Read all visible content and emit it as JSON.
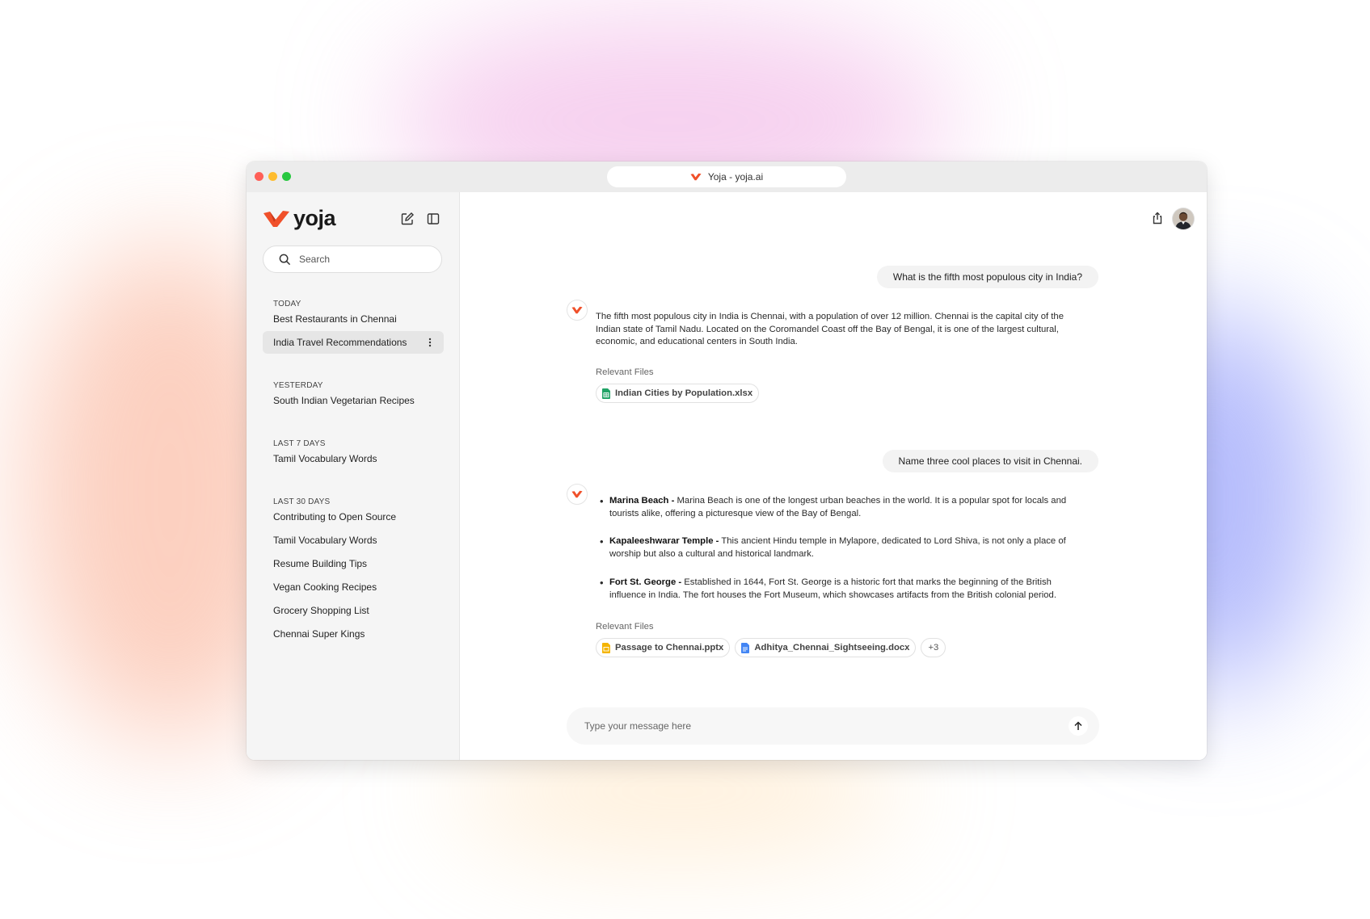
{
  "colors": {
    "brand": "#f0502a",
    "sidebar_bg": "#f5f5f5",
    "active_item_bg": "#e6e6e6",
    "user_bubble_bg": "#f3f3f3",
    "sheet_icon": "#21a366",
    "slides_icon": "#f4b400",
    "doc_icon": "#4285f4"
  },
  "browser": {
    "tab_title": "Yoja - yoja.ai"
  },
  "sidebar": {
    "logo_text": "yoja",
    "search_placeholder": "Search",
    "sections": [
      {
        "title": "TODAY",
        "items": [
          "Best Restaurants in Chennai",
          "India Travel Recommendations"
        ]
      },
      {
        "title": "YESTERDAY",
        "items": [
          "South Indian Vegetarian Recipes"
        ]
      },
      {
        "title": "LAST 7 DAYS",
        "items": [
          "Tamil Vocabulary Words"
        ]
      },
      {
        "title": "LAST 30 DAYS",
        "items": [
          "Contributing to Open Source",
          "Tamil Vocabulary Words",
          "Resume Building Tips",
          "Vegan Cooking Recipes",
          "Grocery Shopping List",
          "Chennai Super Kings"
        ]
      }
    ],
    "active_item": "India Travel Recommendations"
  },
  "conversation": [
    {
      "user": "What is the fifth most populous city in India?",
      "answer": "The fifth most populous city in India is Chennai, with a population of over 12 million. Chennai is the capital city of the Indian state of Tamil Nadu. Located on the Coromandel Coast off the Bay of Bengal, it is one of the largest cultural, economic, and educational centers in South India.",
      "relevant_label": "Relevant Files",
      "files": [
        {
          "name": "Indian Cities by Population.xlsx",
          "icon": "spreadsheet-icon"
        }
      ]
    },
    {
      "user": "Name three cool places to visit in Chennai.",
      "bullets": [
        {
          "title": "Marina Beach -",
          "text": " Marina Beach is one of the longest urban beaches in the world. It is a popular spot for locals and tourists alike, offering a picturesque view of the Bay of Bengal."
        },
        {
          "title": "Kapaleeshwarar Temple -",
          "text": " This ancient Hindu temple in Mylapore, dedicated to Lord Shiva, is not only a place of worship but also a cultural and historical landmark."
        },
        {
          "title": "Fort St. George -",
          "text": " Established in 1644, Fort St. George is a historic fort that marks the beginning of the British influence in India. The fort houses the Fort Museum, which showcases artifacts from the British colonial period."
        }
      ],
      "relevant_label": "Relevant Files",
      "files": [
        {
          "name": "Passage to Chennai.pptx",
          "icon": "slides-icon"
        },
        {
          "name": "Adhitya_Chennai_Sightseeing.docx",
          "icon": "document-icon"
        }
      ],
      "more_files": "+3"
    }
  ],
  "composer": {
    "placeholder": "Type your message here"
  }
}
